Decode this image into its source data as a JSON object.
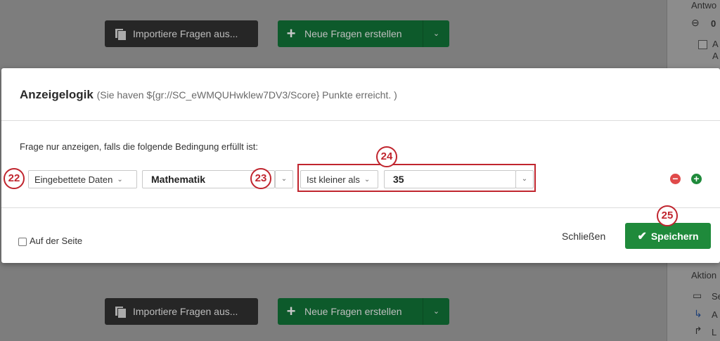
{
  "background": {
    "import_label": "Importiere Fragen aus...",
    "create_label": "Neue Fragen erstellen"
  },
  "side_panel": {
    "top_header": "Antwo",
    "top_count": "0",
    "top_item_line1": "A",
    "top_item_line2": "A",
    "actions_header": "Aktion",
    "action1": "Se",
    "action2": "A",
    "action3": "L"
  },
  "modal": {
    "title": "Anzeigelogik",
    "subtitle": "(Sie haven ${gr://SC_eWMQUHwklew7DV3/Score} Punkte erreicht. )",
    "condition_label": "Frage nur anzeigen, falls die folgende Bedingung erfüllt ist:",
    "source_select": "Eingebettete Daten",
    "field_value": "Mathematik",
    "operator_select": "Ist kleiner als",
    "compare_value": "35",
    "same_page_label": "Auf der Seite",
    "close_label": "Schließen",
    "save_label": "Speichern"
  },
  "annotations": {
    "a22": "22",
    "a23": "23",
    "a24": "24",
    "a25": "25"
  },
  "colors": {
    "accent_green": "#1f8a3b",
    "annotation_red": "#c0252e",
    "remove_red": "#e04a4a",
    "add_green": "#1f8a3b"
  }
}
